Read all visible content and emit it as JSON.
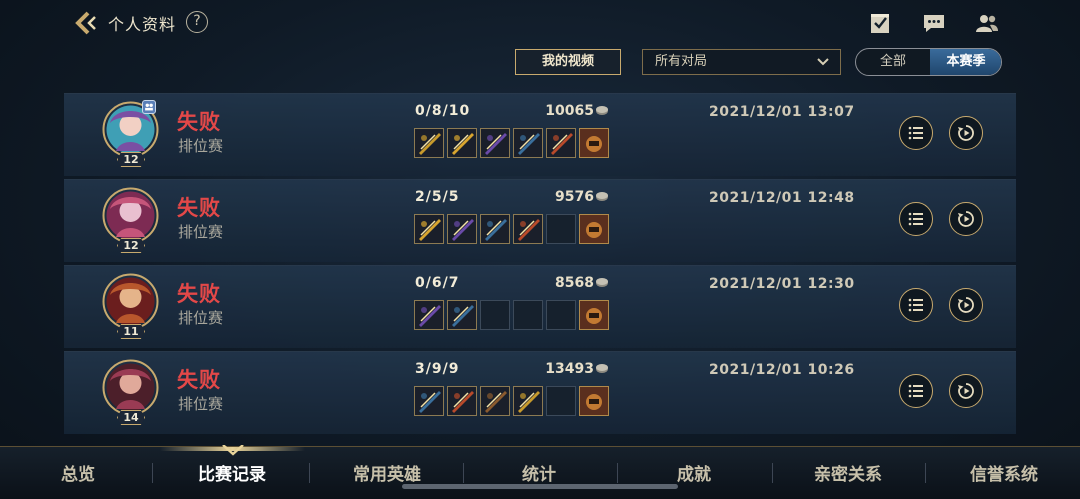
{
  "header": {
    "title": "个人资料",
    "help_label": "?",
    "icons": [
      "back-icon",
      "help-icon",
      "task-check-icon",
      "chat-icon",
      "friends-icon"
    ]
  },
  "filters": {
    "video_button": "我的视频",
    "match_filter": "所有对局",
    "season_toggle": {
      "all": "全部",
      "current": "本赛季",
      "selected": "本赛季"
    }
  },
  "matches": [
    {
      "result": "失败",
      "mode": "排位赛",
      "level": "12",
      "kda": "0/8/10",
      "gold": "10065",
      "time": "2021/12/01 13:07",
      "party": true,
      "items": [
        "item",
        "item",
        "item",
        "item",
        "item",
        "trinket"
      ]
    },
    {
      "result": "失败",
      "mode": "排位赛",
      "level": "12",
      "kda": "2/5/5",
      "gold": "9576",
      "time": "2021/12/01 12:48",
      "party": false,
      "items": [
        "item",
        "item",
        "item",
        "item",
        "empty",
        "trinket"
      ]
    },
    {
      "result": "失败",
      "mode": "排位赛",
      "level": "11",
      "kda": "0/6/7",
      "gold": "8568",
      "time": "2021/12/01 12:30",
      "party": false,
      "items": [
        "item",
        "item",
        "empty",
        "empty",
        "empty",
        "trinket"
      ]
    },
    {
      "result": "失败",
      "mode": "排位赛",
      "level": "14",
      "kda": "3/9/9",
      "gold": "13493",
      "time": "2021/12/01 10:26",
      "party": false,
      "items": [
        "item",
        "item",
        "item",
        "item",
        "empty",
        "trinket"
      ]
    }
  ],
  "nav": {
    "items": [
      "总览",
      "比赛记录",
      "常用英雄",
      "统计",
      "成就",
      "亲密关系",
      "信誉系统"
    ],
    "active": "比赛记录"
  },
  "colors": {
    "accent_gold": "#c8aa6e",
    "defeat_red": "#e34848",
    "season_active": "#2f5c8a"
  }
}
